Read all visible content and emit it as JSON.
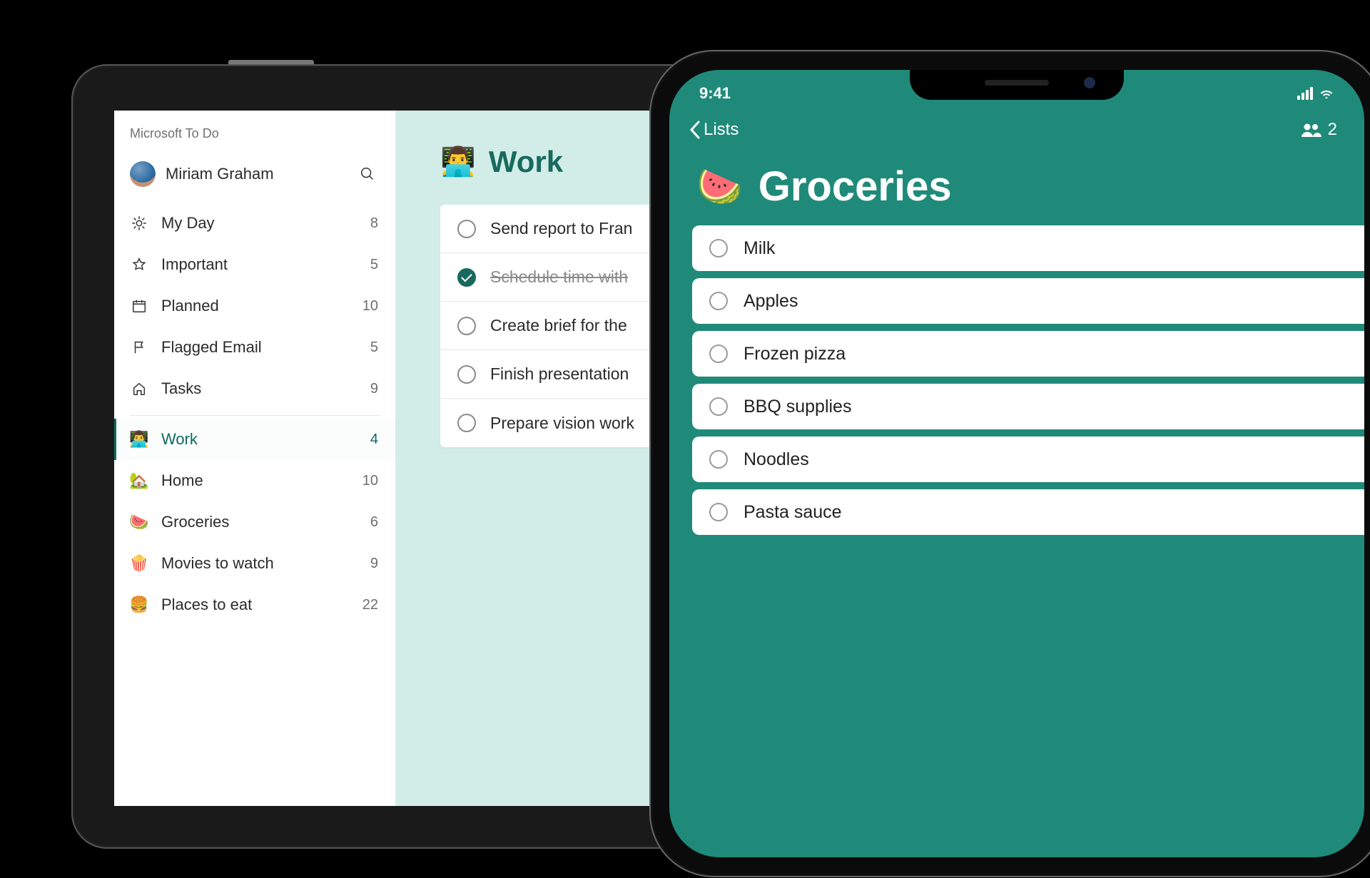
{
  "tablet": {
    "app_title": "Microsoft To Do",
    "user_name": "Miriam Graham",
    "smart_lists": [
      {
        "icon": "sun",
        "label": "My Day",
        "count": "8"
      },
      {
        "icon": "star",
        "label": "Important",
        "count": "5"
      },
      {
        "icon": "calendar",
        "label": "Planned",
        "count": "10"
      },
      {
        "icon": "flag",
        "label": "Flagged Email",
        "count": "5"
      },
      {
        "icon": "home",
        "label": "Tasks",
        "count": "9"
      }
    ],
    "custom_lists": [
      {
        "emoji": "👨‍💻",
        "label": "Work",
        "count": "4",
        "active": true
      },
      {
        "emoji": "🏡",
        "label": "Home",
        "count": "10",
        "active": false
      },
      {
        "emoji": "🍉",
        "label": "Groceries",
        "count": "6",
        "active": false
      },
      {
        "emoji": "🍿",
        "label": "Movies to watch",
        "count": "9",
        "active": false
      },
      {
        "emoji": "🍔",
        "label": "Places to eat",
        "count": "22",
        "active": false
      }
    ],
    "work_pane": {
      "emoji": "👨‍💻",
      "title": "Work",
      "tasks": [
        {
          "label": "Send report to Fran",
          "done": false
        },
        {
          "label": "Schedule time with",
          "done": true
        },
        {
          "label": "Create brief for the",
          "done": false
        },
        {
          "label": "Finish presentation",
          "done": false
        },
        {
          "label": "Prepare vision work",
          "done": false
        }
      ]
    }
  },
  "phone": {
    "status_time": "9:41",
    "back_label": "Lists",
    "share_count": "2",
    "title_emoji": "🍉",
    "title": "Groceries",
    "items": [
      {
        "label": "Milk"
      },
      {
        "label": "Apples"
      },
      {
        "label": "Frozen pizza"
      },
      {
        "label": "BBQ supplies"
      },
      {
        "label": "Noodles"
      },
      {
        "label": "Pasta sauce"
      }
    ]
  }
}
